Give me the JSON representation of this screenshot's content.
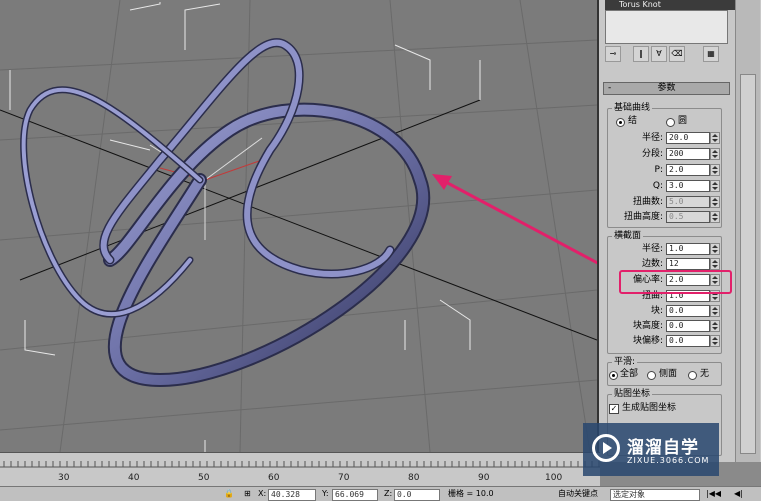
{
  "object_name": "Torus Knot",
  "rollout": {
    "minus": "-",
    "title": "参数"
  },
  "base_curve": {
    "title": "基础曲线",
    "knot_label": "结",
    "circle_label": "圆",
    "selected": "knot",
    "fields": [
      {
        "label": "半径:",
        "value": "20.0",
        "disabled": false
      },
      {
        "label": "分段:",
        "value": "200",
        "disabled": false
      },
      {
        "label": "P:",
        "value": "2.0",
        "disabled": false
      },
      {
        "label": "Q:",
        "value": "3.0",
        "disabled": false
      },
      {
        "label": "扭曲数:",
        "value": "5.0",
        "disabled": true
      },
      {
        "label": "扭曲高度:",
        "value": "0.5",
        "disabled": true
      }
    ]
  },
  "cross_section": {
    "title": "横截面",
    "fields": [
      {
        "label": "半径:",
        "value": "1.0"
      },
      {
        "label": "边数:",
        "value": "12"
      },
      {
        "label": "偏心率:",
        "value": "2.0"
      },
      {
        "label": "扭曲:",
        "value": "1.0"
      },
      {
        "label": "块:",
        "value": "0.0"
      },
      {
        "label": "块高度:",
        "value": "0.0"
      },
      {
        "label": "块偏移:",
        "value": "0.0"
      }
    ]
  },
  "smooth": {
    "title": "平滑:",
    "options": [
      "全部",
      "侧面",
      "无"
    ],
    "selected": 0
  },
  "mapping": {
    "title": "贴图坐标",
    "generate_label": "生成贴图坐标",
    "generate_checked": true
  },
  "timeline": {
    "ticks": [
      "30",
      "40",
      "50",
      "60",
      "70",
      "80",
      "90",
      "100"
    ]
  },
  "statusbar": {
    "x_label": "X:",
    "x_value": "40.328",
    "y_label": "Y:",
    "y_value": "66.069",
    "z_label": "Z:",
    "z_value": "0.0",
    "grid_label": "栅格 = 10.0",
    "autokey_label": "自动关键点",
    "selection_dropdown": "选定对象"
  },
  "watermark": {
    "title": "溜溜自学",
    "subtitle": "ZIXUE.3066.COM"
  },
  "colors": {
    "highlight": "#e2206a",
    "knot": "#6f73a8",
    "viewport_bg": "#7b7b7b"
  }
}
